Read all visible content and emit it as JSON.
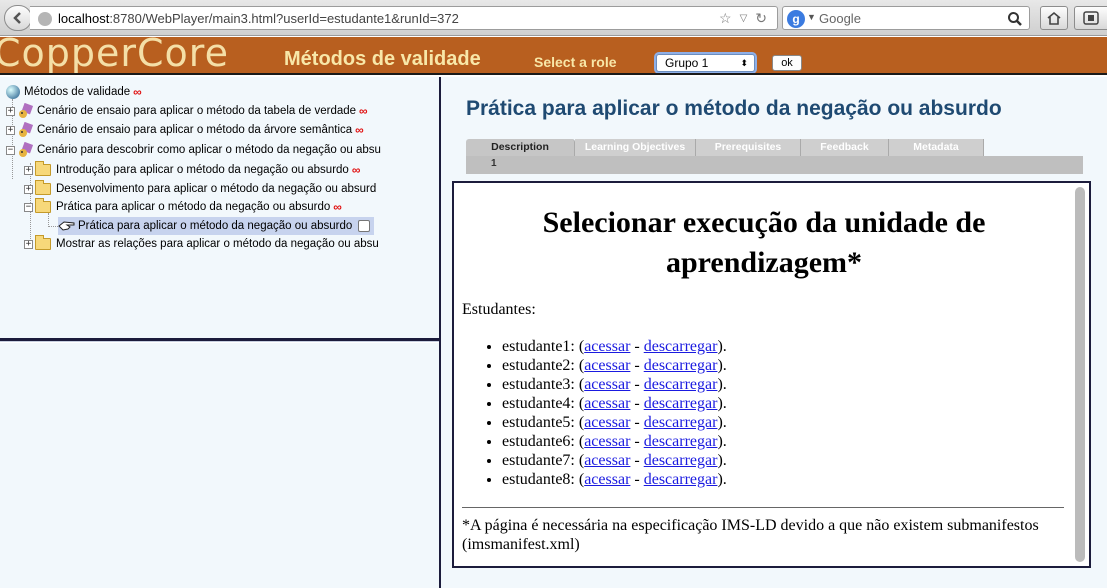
{
  "browser": {
    "url_host": "localhost",
    "url_rest": ":8780/WebPlayer/main3.html?userId=estudante1&runId=372",
    "search_placeholder": "Google",
    "search_engine_letter": "g"
  },
  "header": {
    "logo": "CopperCore",
    "title": "Métodos de validade",
    "select_role_label": "Select a role",
    "role_selected": "Grupo 1",
    "ok_label": "ok"
  },
  "tree": {
    "root": "Métodos de validade",
    "items": [
      {
        "label": "Cenário de ensaio para aplicar o método da tabela de verdade"
      },
      {
        "label": "Cenário de ensaio para aplicar o método da árvore semântica"
      },
      {
        "label": "Cenário para descobrir como aplicar o método da negação ou absu"
      },
      {
        "label": "Introdução para aplicar o método da negação ou absurdo"
      },
      {
        "label": "Desenvolvimento para aplicar o método da negação ou absurd"
      },
      {
        "label": "Prática para aplicar o método da negação ou absurdo"
      },
      {
        "label": "Prática para aplicar o método da negação ou absurdo"
      },
      {
        "label": "Mostrar as relações para aplicar o método da negação ou absu"
      }
    ],
    "infinity_symbol": "∞"
  },
  "activity": {
    "title": "Prática para aplicar o método da negação ou absurdo",
    "tabs": [
      "Description",
      "Learning Objectives",
      "Prerequisites",
      "Feedback",
      "Metadata"
    ],
    "subtab": "1"
  },
  "content": {
    "heading": "Selecionar execução da unidade de aprendizagem*",
    "students_label": "Estudantes:",
    "access_label": "acessar",
    "download_label": "descarregar",
    "students": [
      "estudante1",
      "estudante2",
      "estudante3",
      "estudante4",
      "estudante5",
      "estudante6",
      "estudante7",
      "estudante8"
    ],
    "footnote": "*A página é necessária na especificação IMS-LD devido a que não existem submanifestos (imsmanifest.xml)"
  }
}
